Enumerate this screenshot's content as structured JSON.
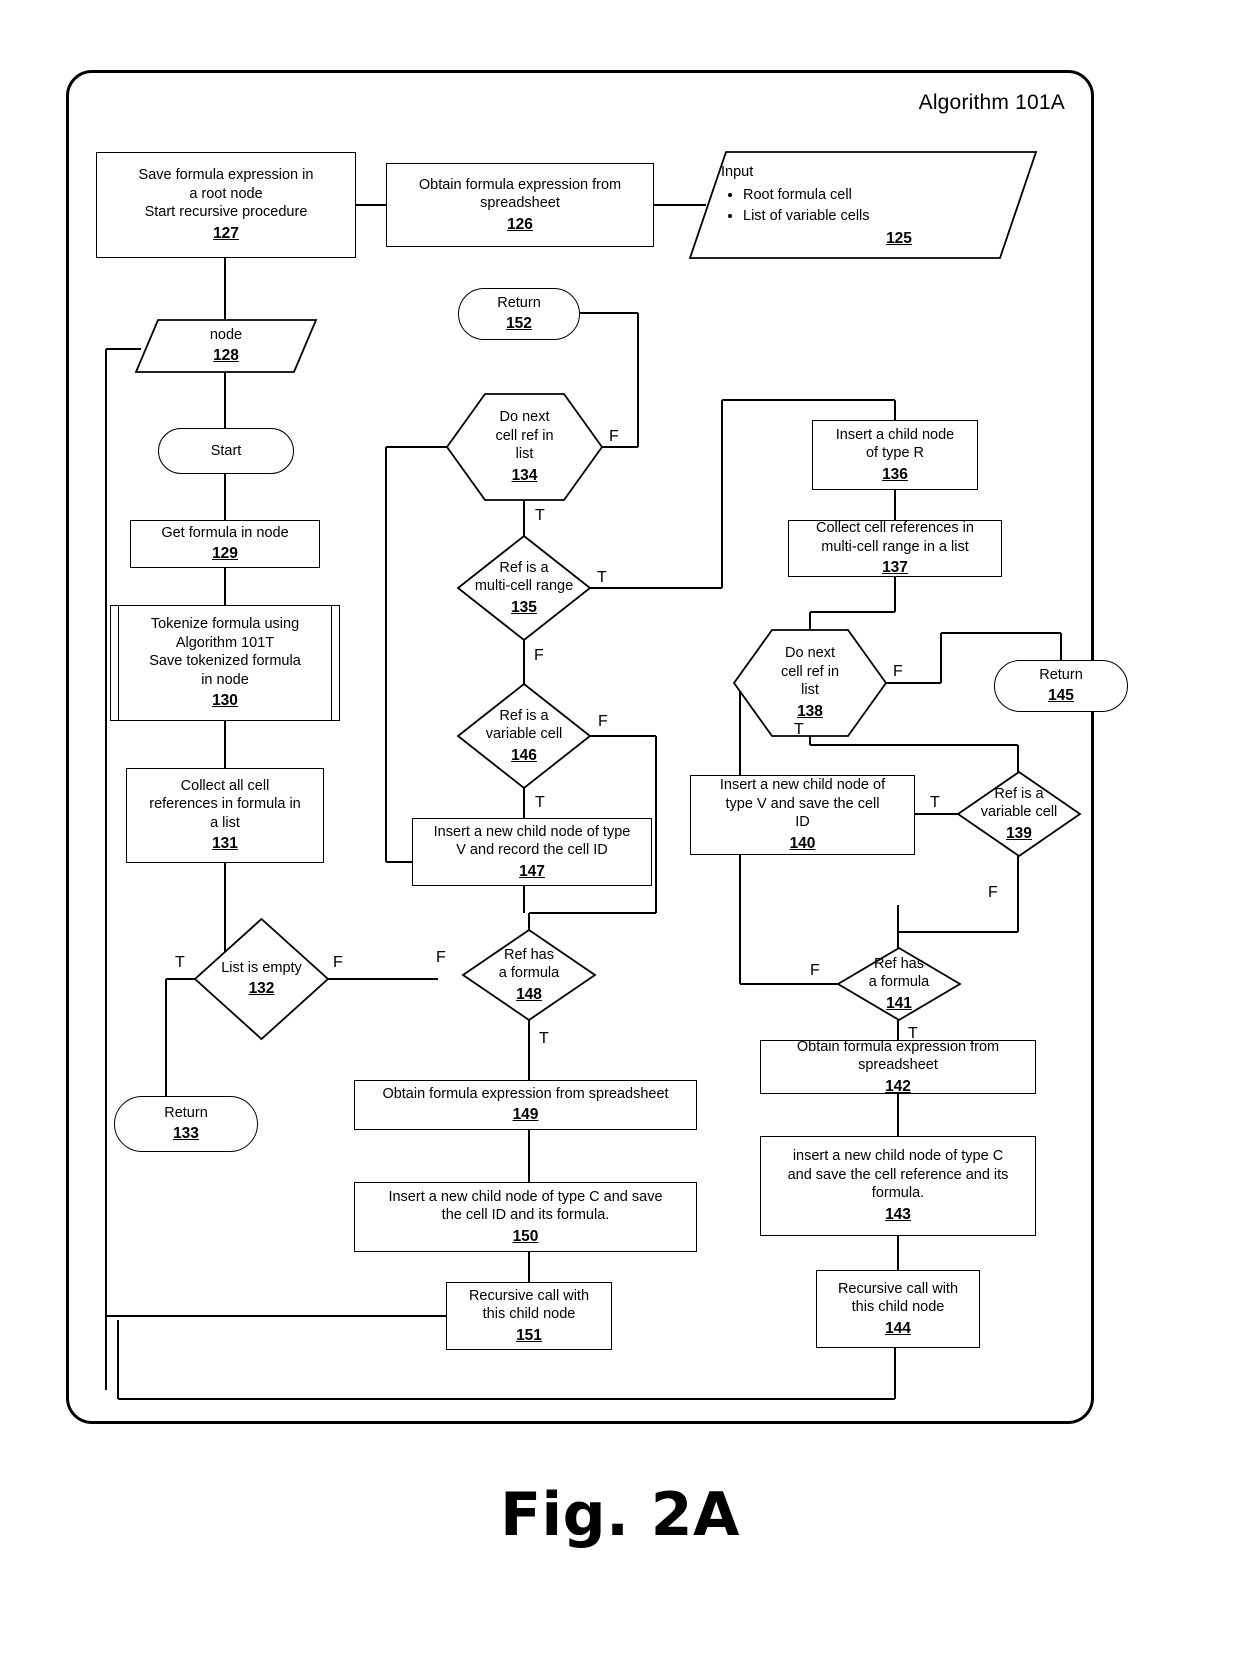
{
  "figure": {
    "caption": "Fig. 2A",
    "algorithm_title": "Algorithm 101A"
  },
  "nodes": {
    "n125": {
      "type": "io",
      "title": "Input",
      "bullets": [
        "Root formula cell",
        "List of variable cells"
      ],
      "num": "125"
    },
    "n126": {
      "type": "process",
      "text": "Obtain formula expression from spreadsheet",
      "num": "126"
    },
    "n127": {
      "type": "process",
      "text": "Save  formula expression in a root node\nStart recursive procedure",
      "line1": "Save  formula expression in",
      "line2": "a root node",
      "line3": "Start recursive procedure",
      "num": "127"
    },
    "n128": {
      "type": "io",
      "text": "node",
      "num": "128"
    },
    "start": {
      "type": "terminator",
      "text": "Start",
      "num": ""
    },
    "n129": {
      "type": "process",
      "text": "Get formula in node",
      "num": "129"
    },
    "n130": {
      "type": "predefined",
      "line1": "Tokenize formula using",
      "line2": "Algorithm 101T",
      "line3": "Save tokenized formula",
      "line4": "in node",
      "num": "130"
    },
    "n131": {
      "type": "process",
      "line1": "Collect all cell",
      "line2": "references in formula in",
      "line3": "a list",
      "num": "131"
    },
    "n132": {
      "type": "decision",
      "line1": "List is empty",
      "num": "132",
      "true_label": "T",
      "false_label": "F"
    },
    "n133": {
      "type": "terminator",
      "text": "Return",
      "num": "133"
    },
    "n134": {
      "type": "loop",
      "line1": "Do next",
      "line2": "cell ref in",
      "line3": "list",
      "num": "134",
      "true_label": "T",
      "false_label": "F"
    },
    "n135": {
      "type": "decision",
      "line1": "Ref is a",
      "line2": "multi-cell range",
      "num": "135",
      "true_label": "T",
      "false_label": "F"
    },
    "n136": {
      "type": "process",
      "line1": "Insert a child node",
      "line2": "of type R",
      "num": "136"
    },
    "n137": {
      "type": "process",
      "line1": "Collect cell references in",
      "line2": "multi-cell range in a list",
      "num": "137"
    },
    "n138": {
      "type": "loop",
      "line1": "Do next",
      "line2": "cell ref in",
      "line3": "list",
      "num": "138",
      "true_label": "T",
      "false_label": "F"
    },
    "n139": {
      "type": "decision",
      "line1": "Ref is a",
      "line2": "variable cell",
      "num": "139",
      "true_label": "T",
      "false_label": "F"
    },
    "n140": {
      "type": "process",
      "line1": "Insert a new child node of",
      "line2": "type V and save the cell",
      "line3": "ID",
      "num": "140"
    },
    "n141": {
      "type": "decision",
      "line1": "Ref has",
      "line2": "a formula",
      "num": "141",
      "true_label": "T",
      "false_label": "F"
    },
    "n142": {
      "type": "process",
      "line1": "Obtain formula expression from",
      "line2": "spreadsheet",
      "num": "142"
    },
    "n143": {
      "type": "process",
      "line1": "insert a new child node of type C",
      "line2": "and save the cell reference and its",
      "line3": "formula.",
      "num": "143"
    },
    "n144": {
      "type": "process",
      "line1": "Recursive call with",
      "line2": "this child node",
      "num": "144"
    },
    "n145": {
      "type": "terminator",
      "text": "Return",
      "num": "145"
    },
    "n146": {
      "type": "decision",
      "line1": "Ref is a",
      "line2": "variable cell",
      "num": "146",
      "true_label": "T",
      "false_label": "F"
    },
    "n147": {
      "type": "process",
      "line1": "Insert a new child node of type",
      "line2": "V and record the cell ID",
      "num": "147"
    },
    "n148": {
      "type": "decision",
      "line1": "Ref has",
      "line2": "a formula",
      "num": "148",
      "true_label": "T",
      "false_label": "F"
    },
    "n149": {
      "type": "process",
      "line1": "Obtain formula expression from spreadsheet",
      "num": "149"
    },
    "n150": {
      "type": "process",
      "line1": "Insert a new child node of type C and save",
      "line2": "the cell ID and its formula.",
      "num": "150"
    },
    "n151": {
      "type": "process",
      "line1": "Recursive call with",
      "line2": "this child node",
      "num": "151"
    },
    "n152": {
      "type": "terminator",
      "text": "Return",
      "num": "152"
    }
  },
  "edge_labels": {
    "e132_T": "T",
    "e132_F": "F",
    "e134_T": "T",
    "e134_F": "F",
    "e135_T": "T",
    "e135_F": "F",
    "e138_T": "T",
    "e138_F": "F",
    "e139_T": "T",
    "e139_F": "F",
    "e141_T": "T",
    "e141_F": "F",
    "e146_T": "T",
    "e146_F": "F",
    "e148_T": "T",
    "e148_F": "F"
  },
  "colors": {
    "line": "#000000",
    "background": "#ffffff"
  }
}
